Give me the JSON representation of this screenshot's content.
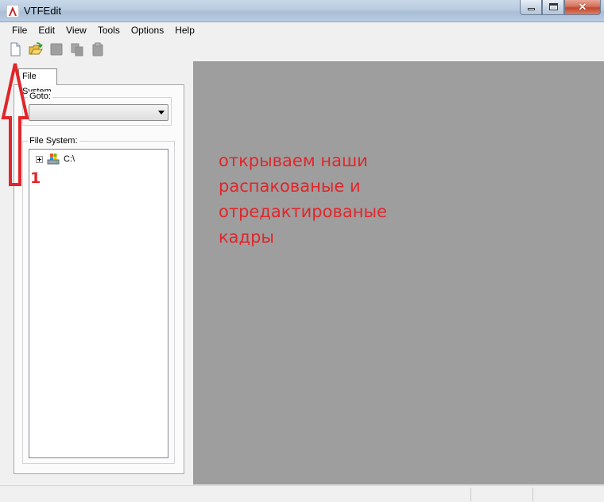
{
  "window": {
    "title": "VTFEdit"
  },
  "menu": {
    "items": [
      "File",
      "Edit",
      "View",
      "Tools",
      "Options",
      "Help"
    ]
  },
  "toolbar": {
    "buttons": [
      "new-file-icon",
      "open-folder-icon",
      "save-icon",
      "copy-icon",
      "paste-icon"
    ]
  },
  "left_panel": {
    "tab_label": "File System",
    "goto_label": "Goto:",
    "goto_value": "",
    "fs_label": "File System:",
    "tree_items": [
      {
        "label": "C:\\"
      }
    ]
  },
  "annotation": {
    "step_number": "1",
    "lines": [
      "открываем наши",
      "распакованые и",
      "отредактированые",
      "кадры"
    ]
  },
  "colors": {
    "annotation": "#e0262a",
    "workspace": "#9e9e9e"
  }
}
